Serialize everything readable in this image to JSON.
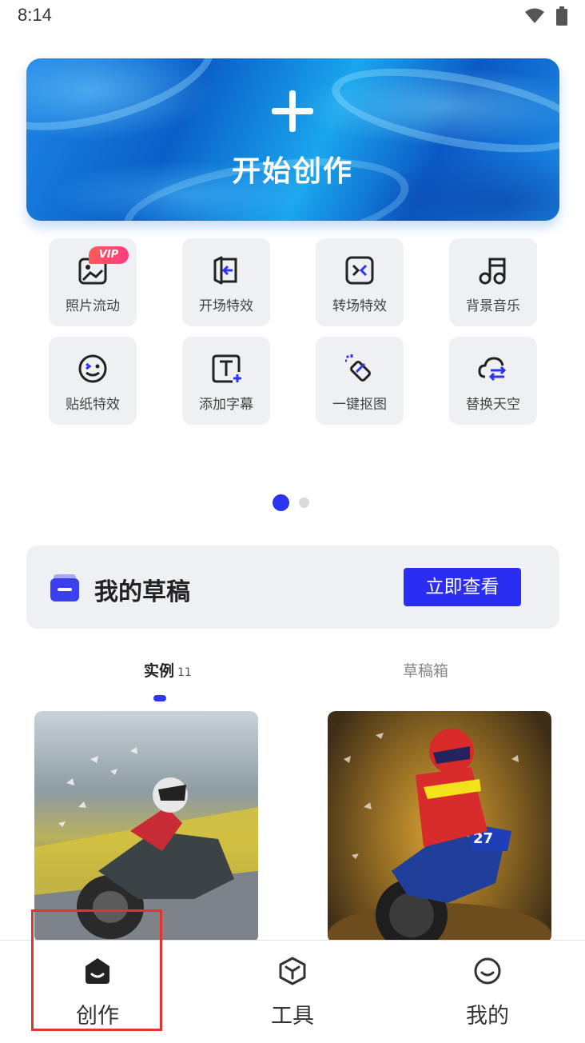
{
  "status_bar": {
    "time": "8:14",
    "icons": [
      "wifi-icon",
      "battery-icon"
    ]
  },
  "hero": {
    "title": "开始创作",
    "icon": "plus-icon"
  },
  "tools": [
    {
      "label": "照片流动",
      "icon": "photo-flow-icon",
      "badge": "VIP"
    },
    {
      "label": "开场特效",
      "icon": "opening-effect-icon"
    },
    {
      "label": "转场特效",
      "icon": "transition-effect-icon"
    },
    {
      "label": "背景音乐",
      "icon": "music-note-icon"
    },
    {
      "label": "贴纸特效",
      "icon": "sticker-face-icon"
    },
    {
      "label": "添加字幕",
      "icon": "add-subtitle-icon"
    },
    {
      "label": "一键抠图",
      "icon": "cutout-eraser-icon"
    },
    {
      "label": "替换天空",
      "icon": "replace-sky-icon"
    }
  ],
  "pager": {
    "pages": 2,
    "active": 1
  },
  "drafts": {
    "title": "我的草稿",
    "button": "立即查看",
    "icon": "drafts-folder-icon"
  },
  "tabs": {
    "examples": {
      "label": "实例",
      "count": "11"
    },
    "draftbox": {
      "label": "草稿箱"
    }
  },
  "examples": [
    {
      "subject": "motorcycle-rider-road"
    },
    {
      "subject": "motocross-rider-dirt"
    }
  ],
  "bottom_nav": [
    {
      "label": "创作",
      "icon": "create-home-icon",
      "selected": true
    },
    {
      "label": "工具",
      "icon": "tools-cube-icon"
    },
    {
      "label": "我的",
      "icon": "profile-smile-icon"
    }
  ],
  "colors": {
    "accent": "#2a2ef2",
    "tile_bg": "#eef0f4",
    "vip": "#ff3d7f",
    "highlight": "#e5322d"
  }
}
